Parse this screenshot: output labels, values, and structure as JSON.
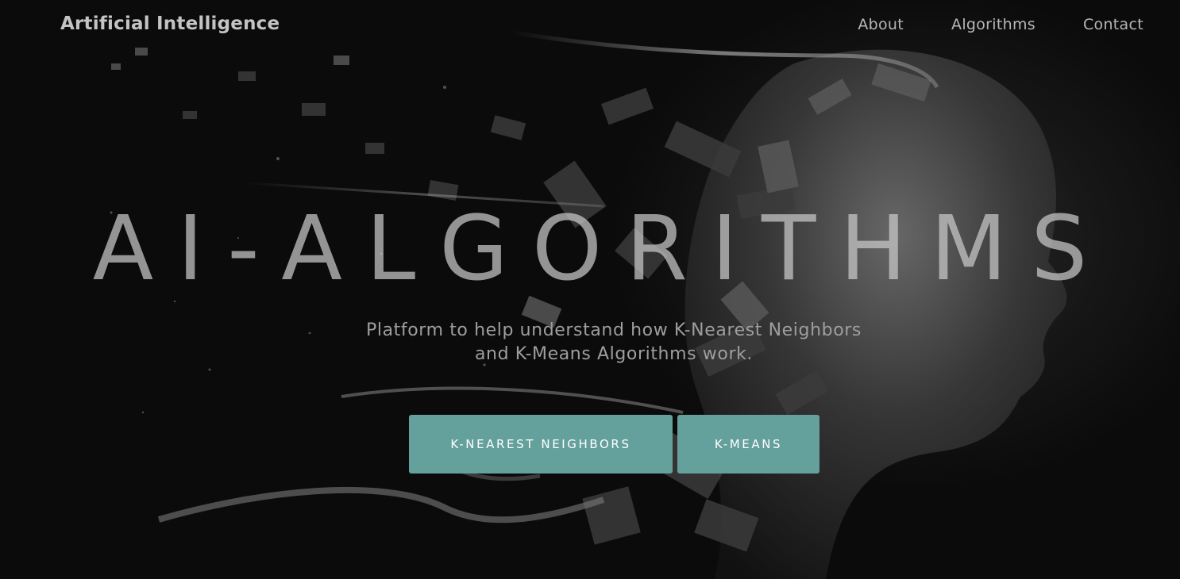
{
  "navbar": {
    "brand": "Artificial Intelligence",
    "links": [
      {
        "label": "About"
      },
      {
        "label": "Algorithms"
      },
      {
        "label": "Contact"
      }
    ]
  },
  "hero": {
    "title": "AI-ALGORITHMS",
    "subtitle": "Platform to help understand how K-Nearest Neighbors and K-Means Algorithms work.",
    "buttons": [
      {
        "label": "K-NEAREST NEIGHBORS"
      },
      {
        "label": "K-MEANS"
      }
    ]
  },
  "theme": {
    "accent": "#64a09c",
    "background": "#0a0a0a",
    "text": "#bdbdbd"
  }
}
